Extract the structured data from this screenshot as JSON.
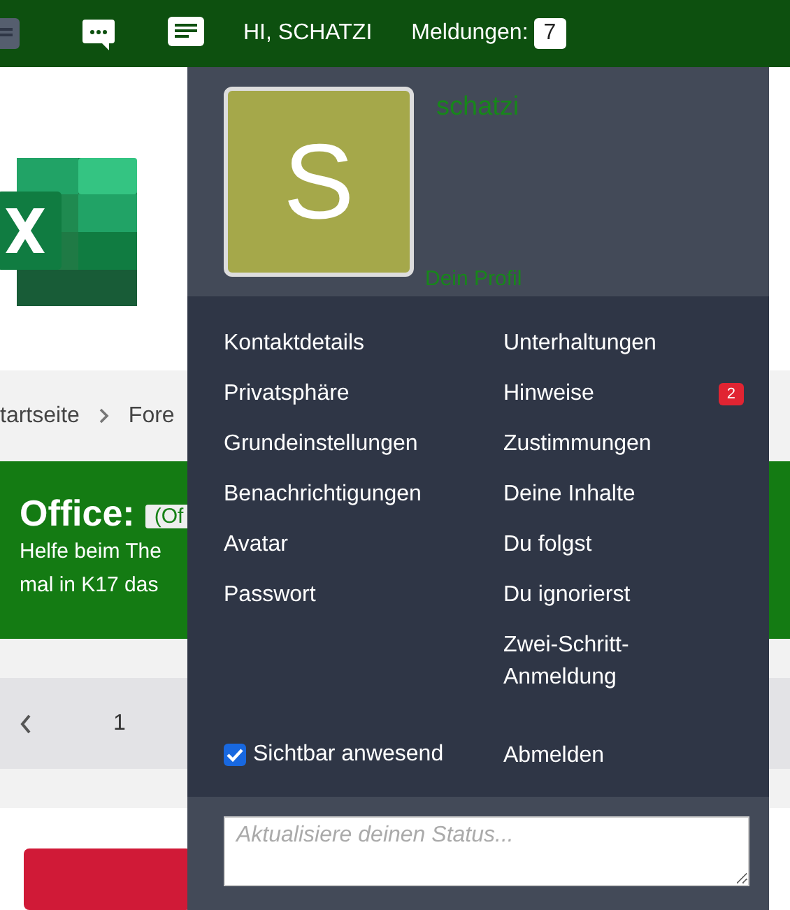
{
  "topbar": {
    "greeting": "HI, SCHATZI",
    "alerts_label": "Meldungen:",
    "alerts_count": "7"
  },
  "page": {
    "breadcrumb": [
      "tartseite",
      "Fore"
    ],
    "banner_title": "Office:",
    "banner_tag": "(Of",
    "banner_lines": [
      "Helfe beim The",
      "mal in K17 das"
    ],
    "page_number": "1"
  },
  "account_menu": {
    "avatar_letter": "S",
    "username": "schatzi",
    "profile_link": "Dein Profil",
    "left_items": [
      "Kontaktdetails",
      "Privatsphäre",
      "Grundeinstellungen",
      "Benachrichtigungen",
      "Avatar",
      "Passwort"
    ],
    "right_items": [
      {
        "label": "Unterhaltungen"
      },
      {
        "label": "Hinweise",
        "badge": "2"
      },
      {
        "label": "Zustimmungen"
      },
      {
        "label": "Deine Inhalte"
      },
      {
        "label": "Du folgst"
      },
      {
        "label": "Du ignorierst"
      },
      {
        "label": "Zwei-Schritt-Anmeldung"
      }
    ],
    "visible_checkbox": {
      "label": "Sichtbar anwesend",
      "checked": true
    },
    "logout": "Abmelden",
    "status_field": {
      "placeholder": "Aktualisiere deinen Status..."
    }
  }
}
